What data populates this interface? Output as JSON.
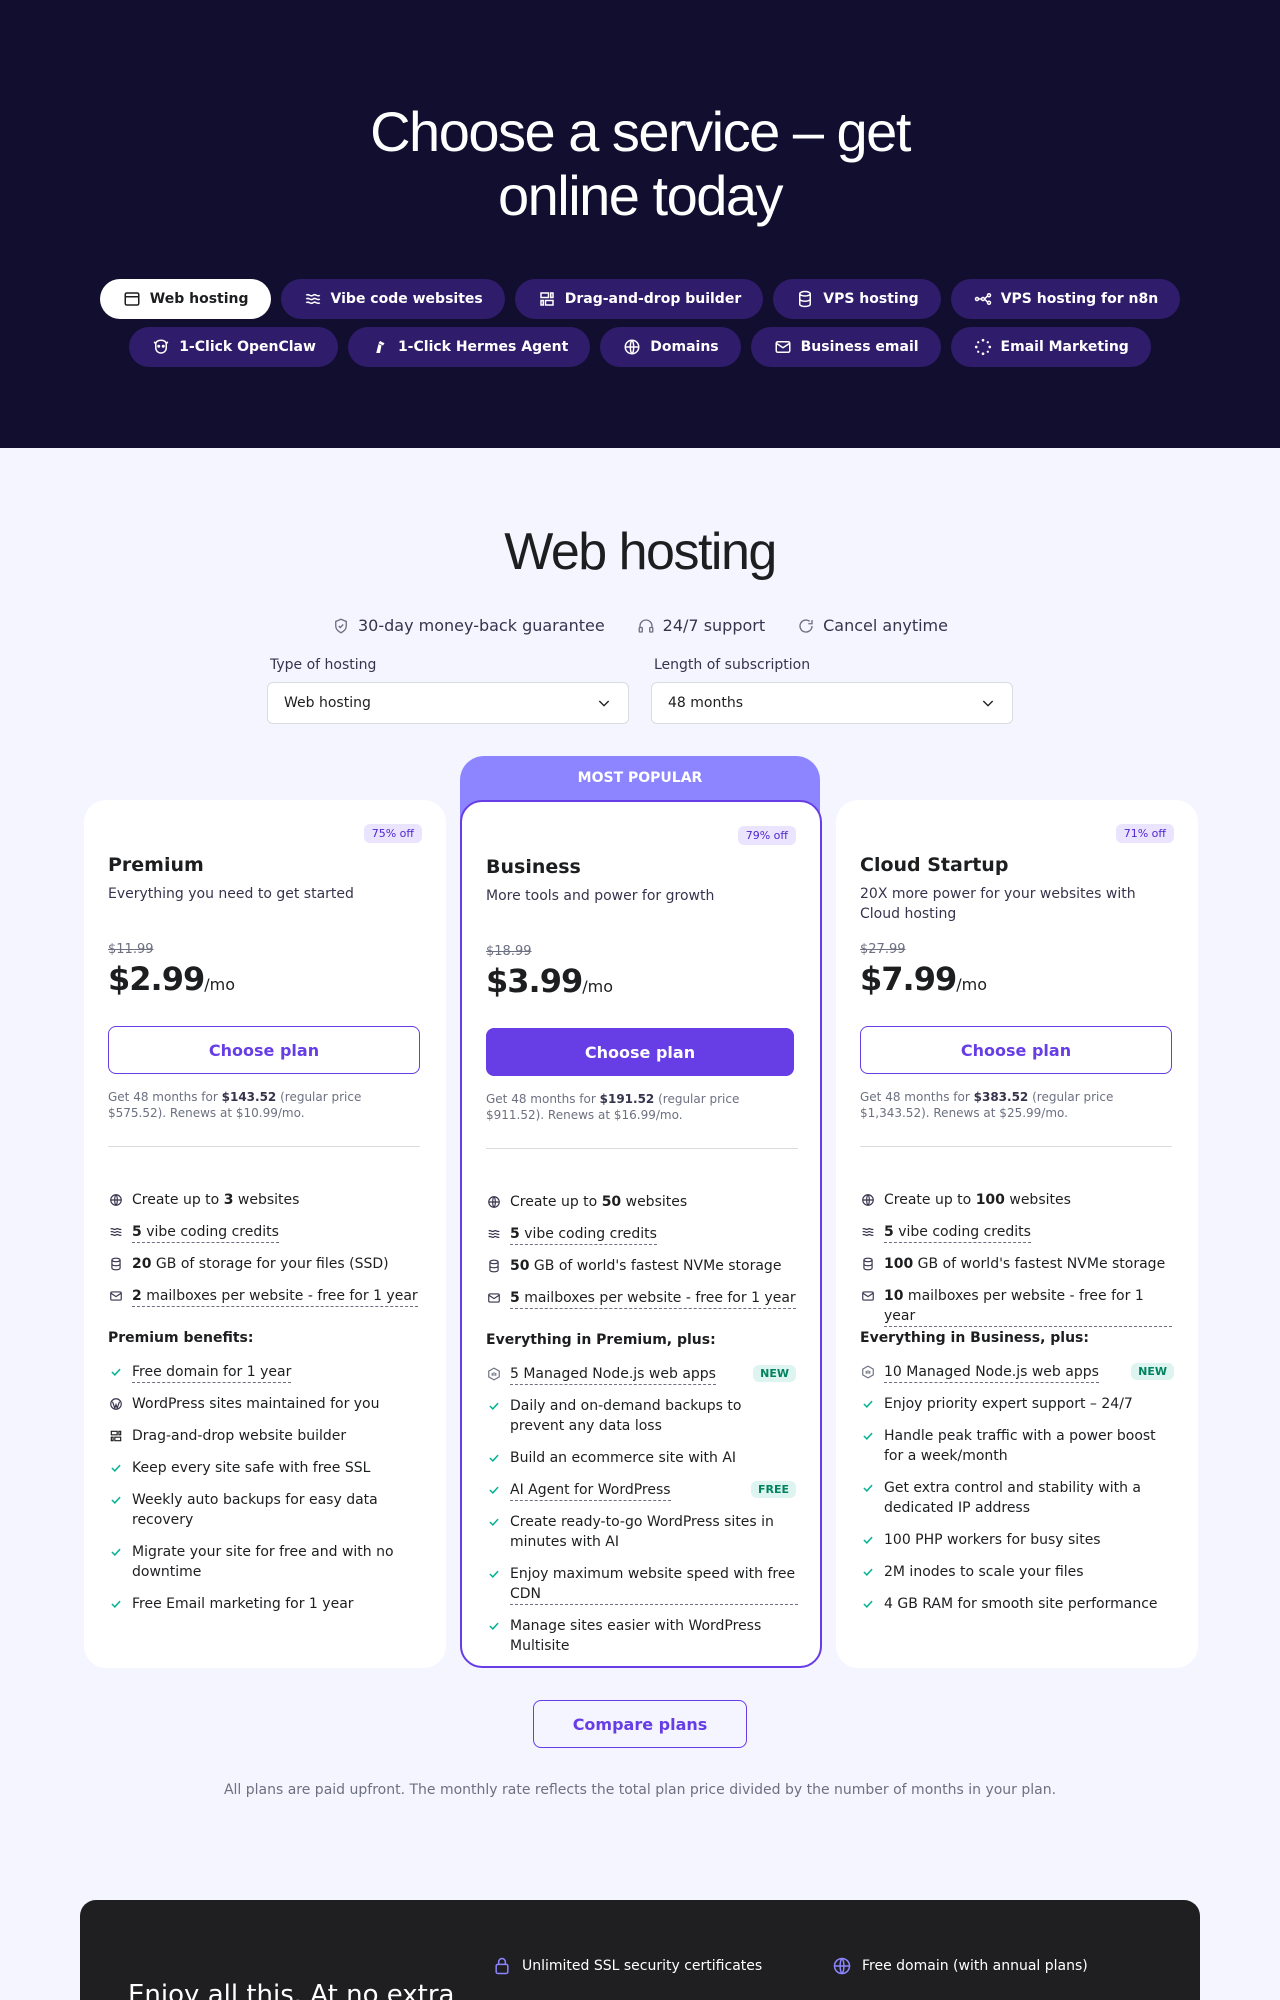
{
  "hero": {
    "title_line1": "Choose a service – get",
    "title_line2": "online today",
    "tabs_row1": [
      {
        "label": "Web hosting",
        "icon": "browser-icon",
        "active": true
      },
      {
        "label": "Vibe code websites",
        "icon": "waves-icon"
      },
      {
        "label": "Drag-and-drop builder",
        "icon": "builder-icon"
      },
      {
        "label": "VPS hosting",
        "icon": "database-icon"
      },
      {
        "label": "VPS hosting for n8n",
        "icon": "n8n-icon"
      }
    ],
    "tabs_row2": [
      {
        "label": "1-Click OpenClaw",
        "icon": "openclaw-icon"
      },
      {
        "label": "1-Click Hermes Agent",
        "icon": "hermes-icon"
      },
      {
        "label": "Domains",
        "icon": "globe-icon"
      },
      {
        "label": "Business email",
        "icon": "mail-icon"
      },
      {
        "label": "Email Marketing",
        "icon": "sparkle-icon"
      }
    ]
  },
  "section": {
    "title": "Web hosting",
    "guarantees": [
      "30-day money-back guarantee",
      "24/7 support",
      "Cancel anytime"
    ],
    "type_label": "Type of hosting",
    "type_value": "Web hosting",
    "length_label": "Length of subscription",
    "length_value": "48 months"
  },
  "popular_label": "MOST POPULAR",
  "plans": [
    {
      "name": "Premium",
      "discount": "75% off",
      "description": "Everything you need to get started",
      "old_price": "$11.99",
      "price": "$2.99",
      "per": "/mo",
      "button": "Choose plan",
      "note_pre": "Get 48 months for ",
      "note_total": "$143.52",
      "note_post": " (regular price $575.52). Renews at $10.99/mo.",
      "features": [
        {
          "icon": "globe-icon",
          "pre": "Create up to ",
          "bold": "3",
          "post": " websites",
          "underline": false
        },
        {
          "icon": "waves-icon",
          "pre": "",
          "bold": "5",
          "post": " vibe coding credits",
          "underline": true
        },
        {
          "icon": "database-icon",
          "pre": "",
          "bold": "20",
          "post": " GB of storage for your files (SSD)",
          "underline": false
        },
        {
          "icon": "mail-icon",
          "pre": "",
          "bold": "2",
          "post": " mailboxes per website - free for 1 year",
          "underline": true
        }
      ],
      "benefits_title": "Premium benefits:",
      "benefits": [
        {
          "icon": "check-icon",
          "text": "Free domain for 1 year",
          "underline": true,
          "tag": ""
        },
        {
          "icon": "wordpress-icon",
          "text": "WordPress sites maintained for you",
          "underline": false,
          "tag": ""
        },
        {
          "icon": "builder-icon",
          "text": "Drag-and-drop website builder",
          "underline": false,
          "tag": ""
        },
        {
          "icon": "check-icon",
          "text": "Keep every site safe with free SSL",
          "underline": false,
          "tag": ""
        },
        {
          "icon": "check-icon",
          "text": "Weekly auto backups for easy data recovery",
          "underline": false,
          "tag": ""
        },
        {
          "icon": "check-icon",
          "text": "Migrate your site for free and with no downtime",
          "underline": false,
          "tag": ""
        },
        {
          "icon": "check-icon",
          "text": "Free Email marketing for 1 year",
          "underline": false,
          "tag": ""
        }
      ]
    },
    {
      "name": "Business",
      "discount": "79% off",
      "description": "More tools and power for growth",
      "old_price": "$18.99",
      "price": "$3.99",
      "per": "/mo",
      "button": "Choose plan",
      "note_pre": "Get 48 months for ",
      "note_total": "$191.52",
      "note_post": " (regular price $911.52). Renews at $16.99/mo.",
      "features": [
        {
          "icon": "globe-icon",
          "pre": "Create up to ",
          "bold": "50",
          "post": " websites",
          "underline": false
        },
        {
          "icon": "waves-icon",
          "pre": "",
          "bold": "5",
          "post": " vibe coding credits",
          "underline": true
        },
        {
          "icon": "database-icon",
          "pre": "",
          "bold": "50",
          "post": " GB of world's fastest NVMe storage",
          "underline": false
        },
        {
          "icon": "mail-icon",
          "pre": "",
          "bold": "5",
          "post": " mailboxes per website - free for 1 year",
          "underline": true
        }
      ],
      "benefits_title": "Everything in Premium, plus:",
      "benefits": [
        {
          "icon": "nodejs-icon",
          "text": "5 Managed Node.js web apps",
          "underline": true,
          "tag": "NEW"
        },
        {
          "icon": "check-icon",
          "text": "Daily and on-demand backups to prevent any data loss",
          "underline": false,
          "tag": ""
        },
        {
          "icon": "check-icon",
          "text": "Build an ecommerce site with AI",
          "underline": false,
          "tag": ""
        },
        {
          "icon": "check-icon",
          "text": "AI Agent for WordPress",
          "underline": true,
          "tag": "FREE"
        },
        {
          "icon": "check-icon",
          "text": "Create ready-to-go WordPress sites in minutes with AI",
          "underline": false,
          "tag": ""
        },
        {
          "icon": "check-icon",
          "text": "Enjoy maximum website speed with free CDN",
          "underline": true,
          "tag": ""
        },
        {
          "icon": "check-icon",
          "text": "Manage sites easier with WordPress Multisite",
          "underline": false,
          "tag": ""
        }
      ]
    },
    {
      "name": "Cloud Startup",
      "discount": "71% off",
      "description": "20X more power for your websites with Cloud hosting",
      "old_price": "$27.99",
      "price": "$7.99",
      "per": "/mo",
      "button": "Choose plan",
      "note_pre": "Get 48 months for ",
      "note_total": "$383.52",
      "note_post": " (regular price $1,343.52). Renews at $25.99/mo.",
      "features": [
        {
          "icon": "globe-icon",
          "pre": "Create up to ",
          "bold": "100",
          "post": " websites",
          "underline": false
        },
        {
          "icon": "waves-icon",
          "pre": "",
          "bold": "5",
          "post": " vibe coding credits",
          "underline": true
        },
        {
          "icon": "database-icon",
          "pre": "",
          "bold": "100",
          "post": " GB of world's fastest NVMe storage",
          "underline": false
        },
        {
          "icon": "mail-icon",
          "pre": "",
          "bold": "10",
          "post": " mailboxes per website - free for 1 year",
          "underline": true
        }
      ],
      "benefits_title": "Everything in Business, plus:",
      "benefits": [
        {
          "icon": "nodejs-icon",
          "text": "10 Managed Node.js web apps",
          "underline": true,
          "tag": "NEW"
        },
        {
          "icon": "check-icon",
          "text": "Enjoy priority expert support – 24/7",
          "underline": false,
          "tag": ""
        },
        {
          "icon": "check-icon",
          "text": "Handle peak traffic with a power boost for a week/month",
          "underline": false,
          "tag": ""
        },
        {
          "icon": "check-icon",
          "text": "Get extra control and stability with a dedicated IP address",
          "underline": false,
          "tag": ""
        },
        {
          "icon": "check-icon",
          "text": "100 PHP workers for busy sites",
          "underline": false,
          "tag": ""
        },
        {
          "icon": "check-icon",
          "text": "2M inodes to scale your files",
          "underline": false,
          "tag": ""
        },
        {
          "icon": "check-icon",
          "text": "4 GB RAM for smooth site performance",
          "underline": false,
          "tag": ""
        }
      ]
    }
  ],
  "compare_label": "Compare plans",
  "footnote": "All plans are paid upfront. The monthly rate reflects the total plan price divided by the number of months in your plan.",
  "bottom": {
    "title": "Enjoy all this. At no extra",
    "items": [
      "Unlimited SSL security certificates",
      "Free domain (with annual plans)"
    ]
  }
}
